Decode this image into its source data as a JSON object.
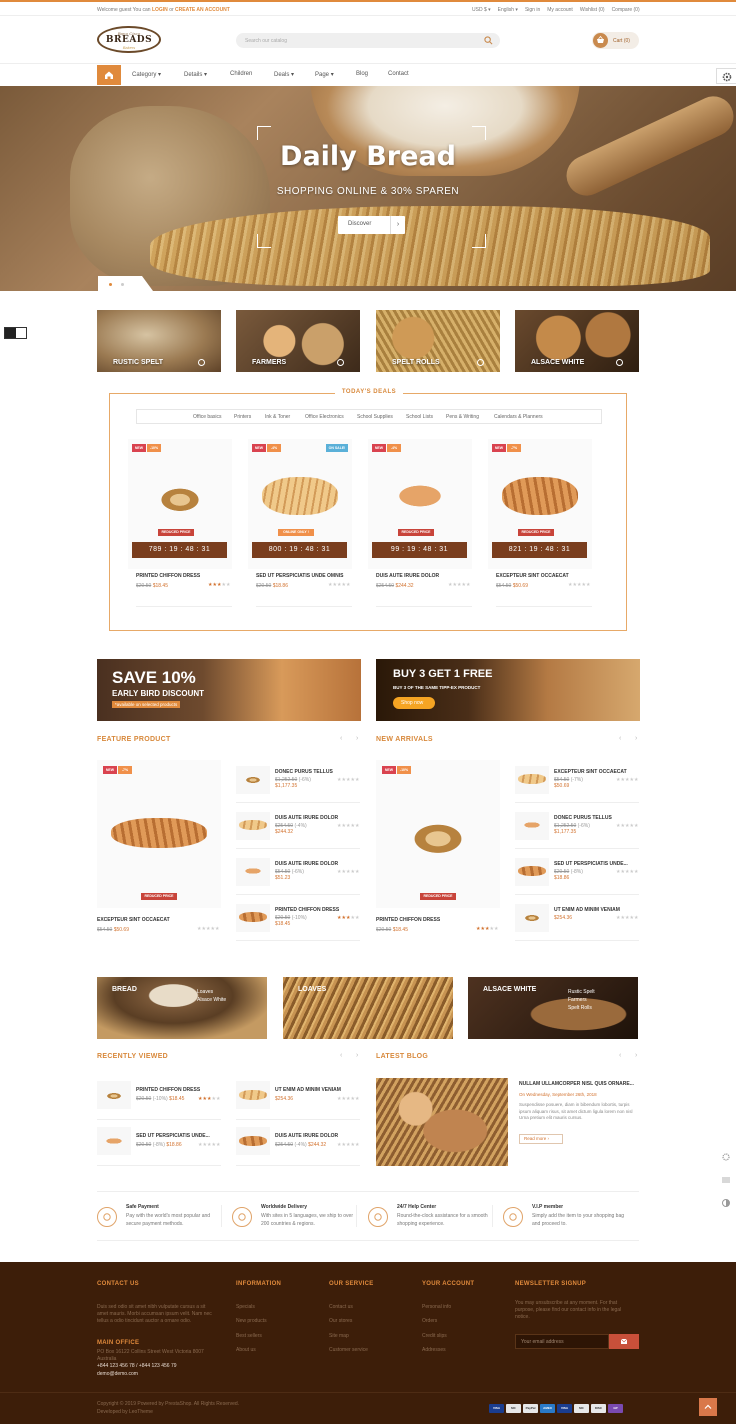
{
  "topbar": {
    "welcome": "Welcome guest You can",
    "login": "LOGIN",
    "or": "or",
    "create": "CREATE AN ACCOUNT",
    "currency": "USD $ ▾",
    "language": "English ▾",
    "signin": "Sign in",
    "account": "My account",
    "wishlist": "Wishlist (0)",
    "compare": "Compare (0)"
  },
  "logo": {
    "script": "Bano Cisco",
    "brand": "BREADS",
    "sub": "Bakers"
  },
  "search": {
    "placeholder": "Search our catalog"
  },
  "cart": {
    "label": "Cart (0)"
  },
  "nav": {
    "items": [
      {
        "label": "Category",
        "caret": "▾"
      },
      {
        "label": "Details",
        "caret": "▾"
      },
      {
        "label": "Children",
        "caret": ""
      },
      {
        "label": "Deals",
        "caret": "▾"
      },
      {
        "label": "Page",
        "caret": "▾"
      },
      {
        "label": "Blog",
        "caret": ""
      },
      {
        "label": "Contact",
        "caret": ""
      }
    ]
  },
  "hero": {
    "title": "Daily Bread",
    "subtitle": "SHOPPING ONLINE & 30% SPAREN",
    "button": "Discover",
    "arrow": "›"
  },
  "categories": [
    {
      "label": "RUSTIC SPELT"
    },
    {
      "label": "FARMERS"
    },
    {
      "label": "SPELT ROLLS"
    },
    {
      "label": "ALSACE WHITE"
    }
  ],
  "deals": {
    "title": "TODAY'S DEALS",
    "tabs": [
      "Office basics",
      "Printers",
      "Ink & Toner",
      "Office Electronics",
      "School Supplies",
      "School Lists",
      "Pens & Writing",
      "Calendars & Planners"
    ],
    "products": [
      {
        "badges": [
          "NEW",
          "-10%"
        ],
        "badge_colors": [
          "#d9434f",
          "#f0904a"
        ],
        "tag": "REDUCED PRICE",
        "tag_color": "#c8443a",
        "timer": "789 : 19 : 48 : 31",
        "name": "PRINTED CHIFFON DRESS",
        "old": "$20.50",
        "price": "$18.45",
        "rating": 3
      },
      {
        "badges": [
          "NEW",
          "-4%"
        ],
        "badge_colors": [
          "#d9434f",
          "#f0904a"
        ],
        "badge2": "ON SALE!",
        "tag": "ONLINE ONLY !",
        "tag_color": "#f0904a",
        "timer": "800 : 19 : 48 : 31",
        "name": "SED UT PERSPICIATIS UNDE OMNIS",
        "old": "$20.50",
        "price": "$18.86",
        "rating": 0
      },
      {
        "badges": [
          "NEW",
          "-4%"
        ],
        "badge_colors": [
          "#d9434f",
          "#f0904a"
        ],
        "tag": "REDUCED PRICE",
        "tag_color": "#c8443a",
        "timer": "99 : 19 : 48 : 31",
        "name": "DUIS AUTE IRURE DOLOR",
        "old": "$254.50",
        "price": "$244.32",
        "rating": 0
      },
      {
        "badges": [
          "NEW",
          "-7%"
        ],
        "badge_colors": [
          "#d9434f",
          "#f0904a"
        ],
        "tag": "REDUCED PRICE",
        "tag_color": "#c8443a",
        "timer": "821 : 19 : 48 : 31",
        "name": "EXCEPTEUR SINT OCCAECAT",
        "old": "$54.50",
        "price": "$50.69",
        "rating": 0
      }
    ]
  },
  "banners": [
    {
      "title": "SAVE 10%",
      "sub": "EARLY BIRD DISCOUNT",
      "note": "*available on selected products"
    },
    {
      "title": "BUY 3 GET 1 FREE",
      "sub": "BUY 3 OF THE SAME TIPP-EX PRODUCT",
      "btn": "Shop now"
    }
  ],
  "feature": {
    "title": "FEATURE PRODUCT",
    "prev": "‹",
    "next": "›",
    "main": {
      "badges": [
        "NEW",
        "-7%"
      ],
      "tag": "REDUCED PRICE",
      "name": "EXCEPTEUR SINT OCCAECAT",
      "old": "$54.50",
      "price": "$50.69",
      "rating": 0
    },
    "list": [
      {
        "name": "DONEC PURUS TELLUS",
        "old": "$1,252.50",
        "pct": "(-6%)",
        "price": "$1,177.35",
        "rating": 0
      },
      {
        "name": "DUIS AUTE IRURE DOLOR",
        "old": "$254.50",
        "pct": "(-4%)",
        "price": "$244.32",
        "rating": 0
      },
      {
        "name": "DUIS AUTE IRURE DOLOR",
        "old": "$54.50",
        "pct": "(-6%)",
        "price": "$51.23",
        "rating": 0
      },
      {
        "name": "PRINTED CHIFFON DRESS",
        "old": "$20.50",
        "pct": "(-10%)",
        "price": "$18.45",
        "rating": 3
      }
    ]
  },
  "arrivals": {
    "title": "NEW ARRIVALS",
    "prev": "‹",
    "next": "›",
    "main": {
      "badges": [
        "NEW",
        "-10%"
      ],
      "tag": "REDUCED PRICE",
      "name": "PRINTED CHIFFON DRESS",
      "old": "$20.50",
      "price": "$18.45",
      "rating": 3
    },
    "list": [
      {
        "name": "EXCEPTEUR SINT OCCAECAT",
        "old": "$54.50",
        "pct": "(-7%)",
        "price": "$50.69",
        "rating": 0
      },
      {
        "name": "DONEC PURUS TELLUS",
        "old": "$1,252.50",
        "pct": "(-6%)",
        "price": "$1,177.35",
        "rating": 0
      },
      {
        "name": "SED UT PERSPICIATIS UNDE...",
        "old": "$20.50",
        "pct": "(-8%)",
        "price": "$18.86",
        "rating": 0
      },
      {
        "name": "UT ENIM AD MINIM VENIAM",
        "old": "",
        "pct": "",
        "price": "$254.36",
        "rating": 0
      }
    ]
  },
  "cats2": [
    {
      "label": "BREAD",
      "items": [
        "Loaves",
        "Alsace White"
      ]
    },
    {
      "label": "LOAVES",
      "items": []
    },
    {
      "label": "ALSACE WHITE",
      "items": [
        "Rustic Spelt",
        "Farmers",
        "Spelt Rolls"
      ]
    }
  ],
  "recent": {
    "title": "RECENTLY VIEWED",
    "prev": "‹",
    "next": "›",
    "items": [
      {
        "name": "PRINTED CHIFFON DRESS",
        "old": "$20.50",
        "pct": "(-10%)",
        "price": "$18.45",
        "rating": 3
      },
      {
        "name": "UT ENIM AD MINIM VENIAM",
        "old": "",
        "pct": "",
        "price": "$254.36",
        "rating": 0
      },
      {
        "name": "SED UT PERSPICIATIS UNDE...",
        "old": "$20.50",
        "pct": "(-8%)",
        "price": "$18.86",
        "rating": 0
      },
      {
        "name": "DUIS AUTE IRURE DOLOR",
        "old": "$254.50",
        "pct": "(-4%)",
        "price": "$244.32",
        "rating": 0
      }
    ]
  },
  "blog": {
    "title": "LATEST BLOG",
    "prev": "‹",
    "next": "›",
    "post_title": "NULLAM ULLAMCORPER NISL QUIS ORNARE...",
    "date": "On Wednesday, September 26th, 2018",
    "body": "Suspendisse posuere, diam in bibendum lobortis, turpis ipsum aliquam risus, sit amet dictum ligula lorem non nisl Urna pretium elit mauris cursus.",
    "more": "Read more",
    "more_arrow": "›"
  },
  "services": [
    {
      "title": "Safe Payment",
      "desc": "Pay with the world's most popular and secure payment methods."
    },
    {
      "title": "Worldwide Delivery",
      "desc": "With sites in 5 languages, we ship to over 200 countries & regions."
    },
    {
      "title": "24/7 Help Center",
      "desc": "Round-the-clock assistance for a smooth shopping experience."
    },
    {
      "title": "V.I.P member",
      "desc": "Simply add the item to your shopping bag and proceed to."
    }
  ],
  "footer": {
    "contact": {
      "title": "CONTACT US",
      "text": "Duis sed odio sit amet nibh vulputate cursus a sit amet mauris. Morbi accumsan ipsum velit. Nam nec tellus a odio tincidunt auctor a ornare odio.",
      "main_office": "MAIN OFFICE",
      "address": "PO Box 16122 Collins Street West Victoria 8007 Australia",
      "phone": "+844 123 456 78 / +844 123 456 79",
      "email": "demo@demo.com"
    },
    "info": {
      "title": "INFORMATION",
      "links": [
        "Specials",
        "New products",
        "Best sellers",
        "About us"
      ]
    },
    "service": {
      "title": "OUR SERVICE",
      "links": [
        "Contact us",
        "Our stores",
        "Site map",
        "Customer service"
      ]
    },
    "account": {
      "title": "YOUR ACCOUNT",
      "links": [
        "Personal info",
        "Orders",
        "Credit slips",
        "Addresses"
      ]
    },
    "newsletter": {
      "title": "NEWSLETTER SIGNUP",
      "text": "You may unsubscribe at any moment. For that purpose, please find our contact info in the legal notice.",
      "placeholder": "Your email address"
    },
    "copyright": "Copyright © 2019 Powered by PrestaShop. All Rights Reserved.",
    "developed": "Developed by LeoTheme",
    "payments": [
      "VISA",
      "MC",
      "PayPal",
      "AMEX",
      "VISA",
      "MC",
      "DISC",
      "GP"
    ]
  },
  "colors": {
    "accent": "#e08a3c",
    "footer_bg": "#3d1e09",
    "timer_bg": "#7a3e1e"
  }
}
